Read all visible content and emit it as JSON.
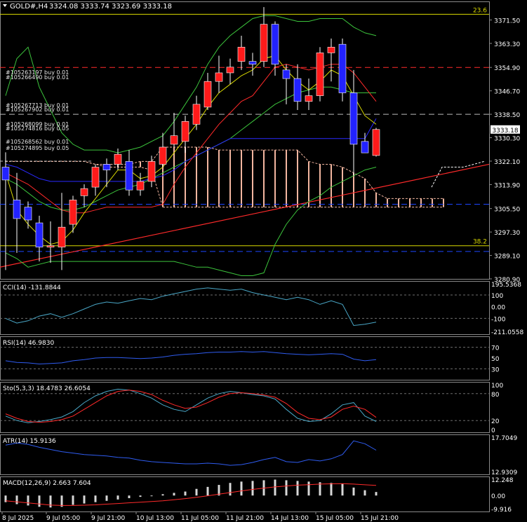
{
  "colors": {
    "background": "#000000",
    "frame": "#8a8a8a",
    "text": "#ffffff",
    "bull_candle": "#ff1a1a",
    "bear_candle": "#2222ff",
    "yellow_line": "#d9d900",
    "red_line": "#ff2a2a",
    "blue_line": "#2a2aff",
    "green_line": "#3cc43c",
    "cloud_fill": "#f3b6a0",
    "cyan_line": "#4aa8c8",
    "navy_line": "#2f5cf0",
    "dark_blue_line": "#1c46ff",
    "gray_level": "#6e6e6e",
    "white": "#ffffff"
  },
  "header": {
    "symbol": "GOLD#,H4",
    "ohlc": "3324.08 3333.74 3323.69 3333.18"
  },
  "current_price_label": "3333.18",
  "main_axis": {
    "ticks": [
      "3371.50",
      "3363.30",
      "3354.90",
      "3346.70",
      "3338.50",
      "3330.30",
      "3322.10",
      "3313.90",
      "3305.50",
      "3297.30",
      "3289.10",
      "3280.90"
    ]
  },
  "time_axis": {
    "labels": [
      "8 Jul 2025",
      "9 Jul 05:00",
      "9 Jul 21:00",
      "10 Jul 13:00",
      "11 Jul 05:00",
      "11 Jul 21:00",
      "14 Jul 13:00",
      "15 Jul 05:00",
      "15 Jul 21:00"
    ]
  },
  "fibo_labels": {
    "top": "23.6",
    "bottom": "38.2"
  },
  "order_labels": [
    "#105263197 buy 0.01",
    "#105266490 buy 0.01",
    "#105267713 buy 0.01",
    "#105267902 buy 0.01",
    "#105268099 buy 0.01",
    "#105274816 buy 0.05",
    "#105268562 buy 0.01",
    "#105274895 buy 0.05"
  ],
  "chart_data": [
    {
      "type": "candlestick",
      "title": "GOLD#,H4",
      "candles": [
        {
          "o": 3320.0,
          "h": 3325.2,
          "l": 3284.0,
          "c": 3315.5
        },
        {
          "o": 3308.5,
          "h": 3318.0,
          "l": 3290.0,
          "c": 3302.0
        },
        {
          "o": 3306.0,
          "h": 3308.0,
          "l": 3298.5,
          "c": 3301.5
        },
        {
          "o": 3300.5,
          "h": 3303.0,
          "l": 3287.0,
          "c": 3292.0
        },
        {
          "o": 3292.0,
          "h": 3301.0,
          "l": 3286.5,
          "c": 3292.5
        },
        {
          "o": 3292.0,
          "h": 3311.0,
          "l": 3284.0,
          "c": 3299.0
        },
        {
          "o": 3300.0,
          "h": 3310.0,
          "l": 3297.0,
          "c": 3308.5
        },
        {
          "o": 3310.0,
          "h": 3314.0,
          "l": 3306.0,
          "c": 3312.5
        },
        {
          "o": 3313.0,
          "h": 3321.0,
          "l": 3310.0,
          "c": 3320.0
        },
        {
          "o": 3321.0,
          "h": 3323.0,
          "l": 3313.0,
          "c": 3319.0
        },
        {
          "o": 3321.0,
          "h": 3326.5,
          "l": 3319.0,
          "c": 3324.5
        },
        {
          "o": 3322.0,
          "h": 3326.0,
          "l": 3310.0,
          "c": 3312.0
        },
        {
          "o": 3312.0,
          "h": 3318.0,
          "l": 3310.0,
          "c": 3315.0
        },
        {
          "o": 3315.0,
          "h": 3324.0,
          "l": 3313.0,
          "c": 3322.0
        },
        {
          "o": 3321.0,
          "h": 3332.0,
          "l": 3320.0,
          "c": 3327.0
        },
        {
          "o": 3328.0,
          "h": 3339.0,
          "l": 3327.0,
          "c": 3331.0
        },
        {
          "o": 3329.0,
          "h": 3338.0,
          "l": 3325.0,
          "c": 3336.0
        },
        {
          "o": 3335.0,
          "h": 3345.0,
          "l": 3333.0,
          "c": 3342.0
        },
        {
          "o": 3341.0,
          "h": 3353.0,
          "l": 3340.0,
          "c": 3350.0
        },
        {
          "o": 3350.0,
          "h": 3359.0,
          "l": 3346.0,
          "c": 3353.0
        },
        {
          "o": 3353.0,
          "h": 3358.0,
          "l": 3349.0,
          "c": 3355.0
        },
        {
          "o": 3357.0,
          "h": 3366.0,
          "l": 3354.0,
          "c": 3362.0
        },
        {
          "o": 3357.0,
          "h": 3360.0,
          "l": 3352.0,
          "c": 3356.0
        },
        {
          "o": 3357.0,
          "h": 3376.0,
          "l": 3355.0,
          "c": 3370.0
        },
        {
          "o": 3370.0,
          "h": 3371.0,
          "l": 3352.0,
          "c": 3356.0
        },
        {
          "o": 3354.0,
          "h": 3356.0,
          "l": 3342.0,
          "c": 3351.0
        },
        {
          "o": 3351.0,
          "h": 3356.0,
          "l": 3340.0,
          "c": 3343.0
        },
        {
          "o": 3343.0,
          "h": 3351.0,
          "l": 3340.0,
          "c": 3345.0
        },
        {
          "o": 3345.0,
          "h": 3362.0,
          "l": 3343.0,
          "c": 3360.0
        },
        {
          "o": 3360.0,
          "h": 3365.0,
          "l": 3350.0,
          "c": 3362.0
        },
        {
          "o": 3363.0,
          "h": 3365.0,
          "l": 3343.0,
          "c": 3346.0
        },
        {
          "o": 3346.0,
          "h": 3354.0,
          "l": 3317.0,
          "c": 3328.0
        },
        {
          "o": 3329.0,
          "h": 3332.0,
          "l": 3325.0,
          "c": 3325.0
        },
        {
          "o": 3324.08,
          "h": 3333.74,
          "l": 3323.69,
          "c": 3333.18
        }
      ],
      "ma_yellow": [
        3318,
        3305,
        3300,
        3296,
        3293,
        3294,
        3298,
        3304,
        3309,
        3314,
        3319,
        3319,
        3316,
        3317,
        3320,
        3325,
        3330,
        3335,
        3341,
        3346,
        3349,
        3352,
        3354,
        3358,
        3359,
        3354,
        3350,
        3347,
        3350,
        3354,
        3352,
        3345,
        3338,
        3335
      ],
      "ma_red": [
        3318,
        3316,
        3314,
        3311,
        3308,
        3305,
        3304,
        3304,
        3305,
        3306,
        3306,
        3306,
        3306,
        3306,
        3307,
        3314,
        3320,
        3325,
        3330,
        3335,
        3339,
        3343,
        3345,
        3350,
        3355,
        3356,
        3355,
        3354,
        3355,
        3356,
        3356,
        3353,
        3348,
        3343
      ],
      "ma_blue": [
        3321,
        3320,
        3318,
        3316,
        3315,
        3315,
        3315,
        3315,
        3315,
        3315,
        3315,
        3315,
        3315,
        3316,
        3317,
        3319,
        3322,
        3324,
        3326,
        3328,
        3330,
        3330,
        3330,
        3330,
        3330,
        3330,
        3330,
        3330,
        3330,
        3330,
        3330,
        3330,
        3330,
        3337
      ],
      "bb_upper": [
        3345,
        3358,
        3362,
        3348,
        3340,
        3332,
        3328,
        3326,
        3326,
        3326,
        3325,
        3326,
        3327,
        3329,
        3331,
        3336,
        3342,
        3348,
        3356,
        3362,
        3366,
        3369,
        3372,
        3373,
        3373,
        3372,
        3371,
        3371,
        3372,
        3372,
        3372,
        3369,
        3367,
        3366
      ],
      "bb_mid": [
        3316,
        3314,
        3311,
        3308,
        3306,
        3305,
        3305,
        3306,
        3308,
        3310,
        3312,
        3313,
        3314,
        3316,
        3318,
        3320,
        3322,
        3324,
        3326,
        3328,
        3330,
        3333,
        3336,
        3339,
        3342,
        3344,
        3346,
        3347,
        3348,
        3348,
        3347,
        3346,
        3346,
        3346
      ],
      "bb_lower": [
        3290,
        3288,
        3285,
        3286,
        3287,
        3287,
        3287,
        3287,
        3287,
        3287,
        3287,
        3287,
        3287,
        3287,
        3287,
        3287,
        3286,
        3285,
        3285,
        3284,
        3283,
        3282,
        3282,
        3283,
        3293,
        3300,
        3305,
        3308,
        3310,
        3313,
        3315,
        3317,
        3319,
        3320
      ],
      "cloud": [
        {
          "t": 3322,
          "b": 3322
        },
        {
          "t": 3322,
          "b": 3322
        },
        {
          "t": 3322,
          "b": 3322
        },
        {
          "t": 3322,
          "b": 3322
        },
        {
          "t": 3322,
          "b": 3322
        },
        {
          "t": 3322,
          "b": 3322
        },
        {
          "t": 3322,
          "b": 3322
        },
        {
          "t": 3322,
          "b": 3322
        },
        {
          "t": 3321,
          "b": 3321
        },
        {
          "t": 3321,
          "b": 3320
        },
        {
          "t": 3321,
          "b": 3320
        },
        {
          "t": 3321,
          "b": 3320
        },
        {
          "t": 3322,
          "b": 3320
        },
        {
          "t": 3322,
          "b": 3319
        },
        {
          "t": 3327,
          "b": 3306
        },
        {
          "t": 3327,
          "b": 3306
        },
        {
          "t": 3327,
          "b": 3306
        },
        {
          "t": 3327,
          "b": 3306
        },
        {
          "t": 3327,
          "b": 3306
        },
        {
          "t": 3326,
          "b": 3306
        },
        {
          "t": 3326,
          "b": 3306
        },
        {
          "t": 3326,
          "b": 3306
        },
        {
          "t": 3326,
          "b": 3306
        },
        {
          "t": 3326,
          "b": 3306
        },
        {
          "t": 3326,
          "b": 3306
        },
        {
          "t": 3326,
          "b": 3306
        },
        {
          "t": 3326,
          "b": 3306
        },
        {
          "t": 3322,
          "b": 3306
        },
        {
          "t": 3321,
          "b": 3306
        },
        {
          "t": 3321,
          "b": 3306
        },
        {
          "t": 3320,
          "b": 3306
        },
        {
          "t": 3318,
          "b": 3306
        },
        {
          "t": 3316,
          "b": 3306
        },
        {
          "t": 3311,
          "b": 3306
        },
        {
          "t": 3309,
          "b": 3306
        },
        {
          "t": 3309,
          "b": 3306
        },
        {
          "t": 3309,
          "b": 3306
        },
        {
          "t": 3309,
          "b": 3306
        },
        {
          "t": 3309,
          "b": 3306
        },
        {
          "t": 3309,
          "b": 3306
        },
        {
          "t": 3309,
          "b": 3306
        }
      ],
      "forecast_line": [
        3313,
        3320,
        3320,
        3320,
        3321,
        3322
      ],
      "trendline_value": [
        3285,
        3321
      ],
      "levels": {
        "fibo_23_6": 3373.5,
        "fibo_38_2": 3292.5,
        "red_dash": 3354.9,
        "white_dash": 3338.5,
        "blue_dash_upper": 3307.0,
        "blue_dash_lower": 3290.5
      },
      "ylim": [
        3280.9,
        3378.0
      ]
    },
    {
      "type": "line",
      "title": "CCI(14) -131.8844",
      "ticks": [
        "195.5368",
        "100",
        "0.00",
        "-100",
        "-211.0558"
      ],
      "levels": [
        100,
        -100
      ],
      "ylim": [
        -211.0558,
        195.5368
      ],
      "series": [
        {
          "values": [
            -100,
            -140,
            -120,
            -80,
            -60,
            -90,
            -60,
            -20,
            20,
            40,
            30,
            50,
            70,
            60,
            90,
            110,
            130,
            150,
            160,
            150,
            140,
            150,
            120,
            100,
            80,
            60,
            80,
            60,
            20,
            50,
            20,
            -160,
            -150,
            -132
          ]
        }
      ]
    },
    {
      "type": "line",
      "title": "RSI(14) 46.9830",
      "ticks": [
        "70",
        "50",
        "30"
      ],
      "levels": [
        70,
        30
      ],
      "ylim": [
        15,
        85
      ],
      "series": [
        {
          "values": [
            45,
            42,
            41,
            39,
            40,
            41,
            45,
            47,
            50,
            51,
            51,
            50,
            49,
            50,
            52,
            55,
            57,
            58,
            60,
            61,
            61,
            62,
            61,
            62,
            60,
            58,
            57,
            56,
            57,
            58,
            57,
            48,
            45,
            47
          ]
        }
      ]
    },
    {
      "type": "line",
      "title": "Sto(5,3,3) 18.4783 26.6054",
      "ticks": [
        "100",
        "80",
        "20",
        "0"
      ],
      "levels": [
        80,
        20
      ],
      "ylim": [
        0,
        100
      ],
      "series": [
        {
          "values": [
            30,
            20,
            15,
            18,
            22,
            28,
            40,
            60,
            75,
            85,
            90,
            88,
            80,
            70,
            55,
            45,
            40,
            55,
            70,
            80,
            85,
            82,
            78,
            75,
            68,
            45,
            25,
            18,
            20,
            35,
            55,
            60,
            30,
            18
          ]
        },
        {
          "values": [
            35,
            25,
            18,
            16,
            18,
            22,
            30,
            45,
            60,
            75,
            85,
            88,
            85,
            78,
            65,
            55,
            47,
            50,
            60,
            72,
            80,
            82,
            80,
            77,
            72,
            58,
            38,
            25,
            22,
            28,
            45,
            52,
            45,
            27
          ]
        }
      ]
    },
    {
      "type": "line",
      "title": "ATR(14) 15.9136",
      "ticks": [
        "17.7049",
        "12.9309"
      ],
      "ylim": [
        12.9309,
        17.7049
      ],
      "series": [
        {
          "values": [
            16.6,
            16.9,
            16.7,
            16.3,
            16.0,
            15.7,
            15.5,
            15.3,
            15.2,
            15.1,
            14.9,
            14.8,
            14.5,
            14.3,
            14.2,
            14.1,
            14.0,
            14.0,
            14.1,
            14.0,
            13.8,
            13.9,
            14.2,
            14.6,
            14.9,
            14.3,
            14.2,
            14.6,
            14.4,
            14.7,
            15.3,
            17.2,
            16.8,
            15.9
          ]
        }
      ]
    },
    {
      "type": "bar",
      "title": "MACD(12,26,9) 2.663 7.604",
      "ticks": [
        "12.248",
        "0.00",
        "-9.916"
      ],
      "ylim": [
        -9.916,
        12.248
      ],
      "values": [
        -5,
        -6.5,
        -7.5,
        -8.5,
        -9,
        -8.5,
        -7,
        -6,
        -5,
        -4,
        -3,
        -2,
        -1,
        0,
        1,
        2,
        3,
        5,
        6.5,
        8,
        9.5,
        10.5,
        11,
        11.5,
        12,
        11.5,
        11,
        10.5,
        10,
        9.5,
        9,
        6,
        4,
        2.663
      ],
      "series": [
        {
          "values": [
            -4,
            -4.8,
            -5.6,
            -6.4,
            -7.2,
            -7.5,
            -7.5,
            -7.3,
            -7.0,
            -6.5,
            -6.0,
            -5.5,
            -5.0,
            -4.5,
            -4.0,
            -3.2,
            -2.3,
            -1.3,
            -0.2,
            1.0,
            2.2,
            3.5,
            4.6,
            5.6,
            6.5,
            7.2,
            7.8,
            8.2,
            8.6,
            8.8,
            8.9,
            8.6,
            8.1,
            7.6
          ]
        }
      ]
    }
  ]
}
